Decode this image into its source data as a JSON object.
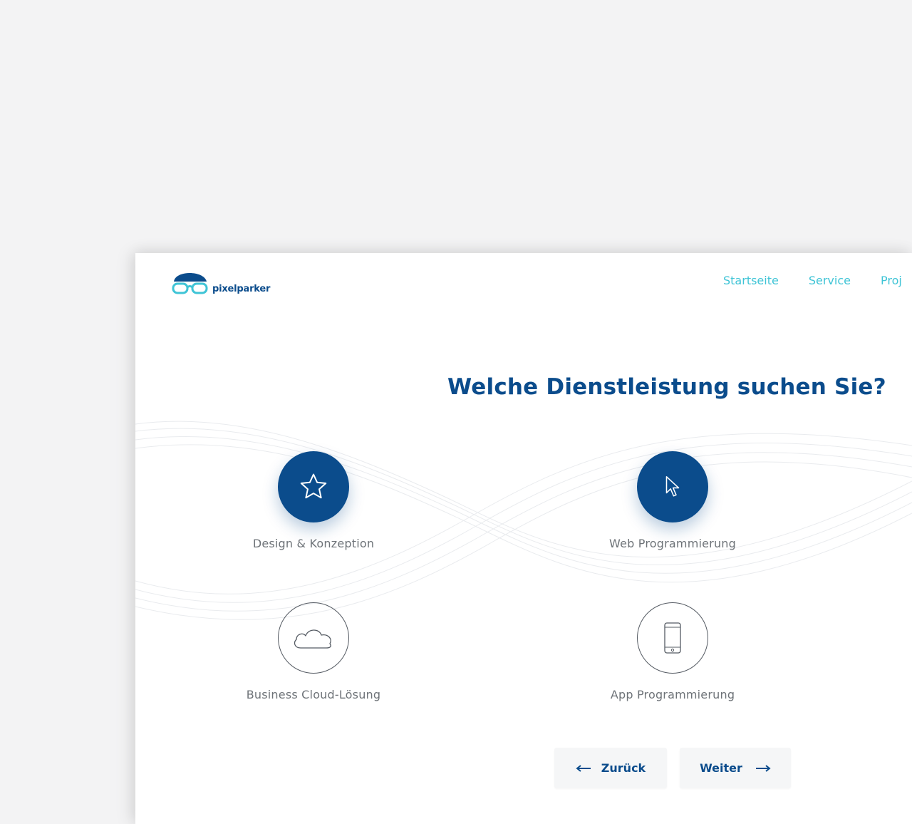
{
  "logo": {
    "text": "pixelparker"
  },
  "nav": [
    "Startseite",
    "Service",
    "Proj"
  ],
  "headline": "Welche Dienstleistung suchen Sie?",
  "options": [
    {
      "label": "Design & Konzeption",
      "icon": "star-icon",
      "style": "filled"
    },
    {
      "label": "Web Programmierung",
      "icon": "cursor-icon",
      "style": "filled"
    },
    {
      "label": "Business Cloud-Lösung",
      "icon": "cloud-icon",
      "style": "outline"
    },
    {
      "label": "App Programmierung",
      "icon": "smartphone-icon",
      "style": "outline"
    }
  ],
  "buttons": {
    "back": "Zurück",
    "next": "Weiter"
  },
  "colors": {
    "primary": "#0b4c8c",
    "accent": "#3fc4d6",
    "background": "#f3f3f4"
  }
}
